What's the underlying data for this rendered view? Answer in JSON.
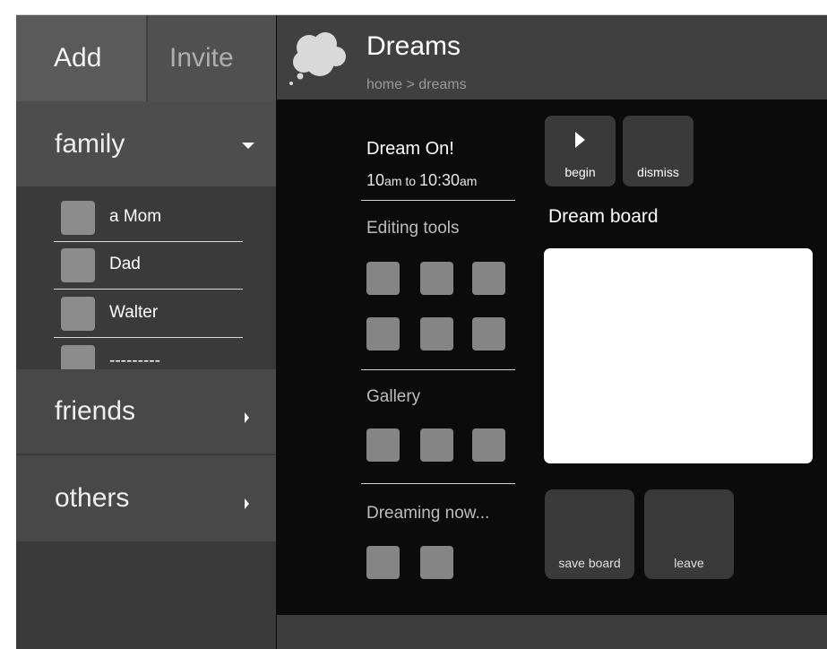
{
  "sidebar": {
    "tabs": {
      "add": "Add",
      "invite": "Invite"
    },
    "groups": {
      "family": {
        "label": "family",
        "expanded": true,
        "members": [
          "a Mom",
          "Dad",
          "Walter",
          "---------"
        ]
      },
      "friends": {
        "label": "friends",
        "expanded": false
      },
      "others": {
        "label": "others",
        "expanded": false
      }
    }
  },
  "header": {
    "title": "Dreams",
    "breadcrumb": "home > dreams",
    "icon": "thought-cloud-icon"
  },
  "event": {
    "title": "Dream On!",
    "start_num": "10",
    "start_suffix": "am",
    "to": " to ",
    "end_num": "10:30",
    "end_suffix": "am"
  },
  "sections": {
    "editing_tools": "Editing tools",
    "gallery": "Gallery",
    "dreaming_now": "Dreaming now..."
  },
  "controls": {
    "begin": "begin",
    "dismiss": "dismiss"
  },
  "board": {
    "title": "Dream board"
  },
  "actions": {
    "save": "save board",
    "leave": "leave"
  },
  "colors": {
    "background": "#0b0b0b",
    "sidebar": "#3a3a3a",
    "header": "#404040",
    "tile": "#858585",
    "board": "#ffffff"
  }
}
